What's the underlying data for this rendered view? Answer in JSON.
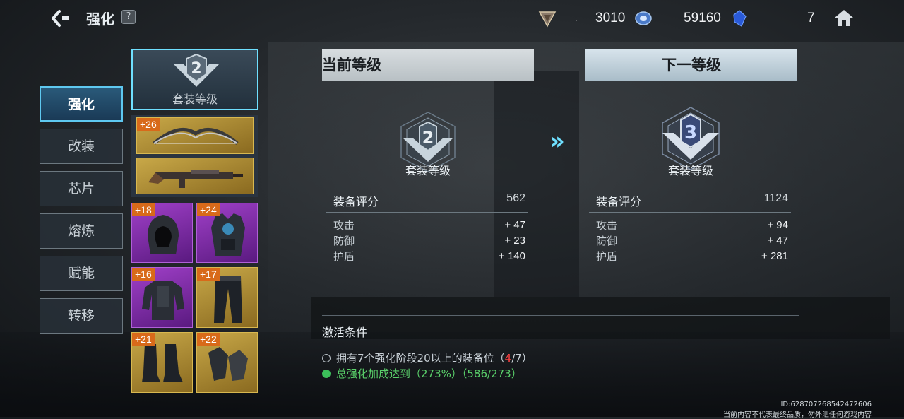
{
  "header": {
    "title": "强化",
    "help": "?",
    "currencies": [
      {
        "icon": "shield-emblem-icon",
        "value": "3010"
      },
      {
        "icon": "blue-orb-icon",
        "value": "59160"
      },
      {
        "icon": "blue-gem-icon",
        "value": "7"
      }
    ],
    "dot": "."
  },
  "tabs": [
    "强化",
    "改装",
    "芯片",
    "熔炼",
    "赋能",
    "转移"
  ],
  "active_tab": 0,
  "suit_card": {
    "level": "2",
    "label": "套装等级"
  },
  "items": [
    {
      "badge": "+26",
      "kind": "bow",
      "rarity": "gold"
    },
    {
      "badge": "",
      "kind": "rifle",
      "rarity": "gold"
    },
    {
      "badge": "+18",
      "kind": "hood",
      "rarity": "purple"
    },
    {
      "badge": "+24",
      "kind": "vest",
      "rarity": "purple"
    },
    {
      "badge": "+16",
      "kind": "armor",
      "rarity": "purple"
    },
    {
      "badge": "+17",
      "kind": "pants",
      "rarity": "gold"
    },
    {
      "badge": "+21",
      "kind": "boots",
      "rarity": "gold"
    },
    {
      "badge": "+22",
      "kind": "gloves",
      "rarity": "gold"
    }
  ],
  "current": {
    "header": "当前等级",
    "level": "2",
    "label": "套装等级",
    "score_label": "装备评分",
    "score": "562",
    "stats": [
      {
        "name": "攻击",
        "value": "+ 47"
      },
      {
        "name": "防御",
        "value": "+ 23"
      },
      {
        "name": "护盾",
        "value": "+ 140"
      }
    ]
  },
  "next": {
    "header": "下一等级",
    "level": "3",
    "label": "套装等级",
    "score_label": "装备评分",
    "score": "1124",
    "stats": [
      {
        "name": "攻击",
        "value": "+ 94"
      },
      {
        "name": "防御",
        "value": "+ 47"
      },
      {
        "name": "护盾",
        "value": "+ 281"
      }
    ]
  },
  "arrows": "»",
  "conditions": {
    "title": "激活条件",
    "c1_prefix": "拥有7个强化阶段20以上的装备位（",
    "c1_have": "4",
    "c1_suffix": "/7）",
    "c2_text": "总强化加成达到（273%）（586/273）"
  },
  "watermark": {
    "id": "ID:628707268542472606",
    "notice": "当前内容不代表最终品质，勿外泄任何游戏内容"
  },
  "colors": {
    "accent": "#6fe0ff",
    "active_tab": "#2a5a7a",
    "badge": "#d86a1a",
    "ok": "#3cc05a",
    "warn": "#ff4040"
  }
}
